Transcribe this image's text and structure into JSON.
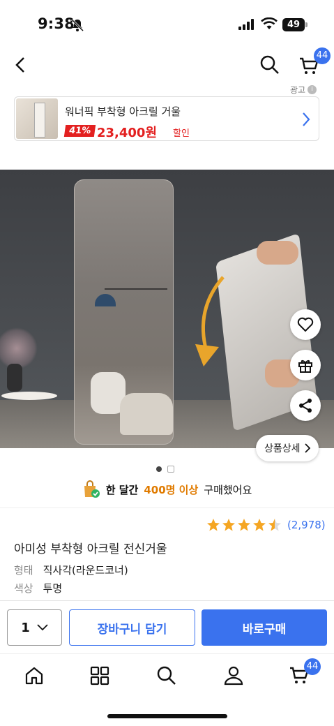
{
  "status_bar": {
    "time": "9:38",
    "battery": "49"
  },
  "header": {
    "cart_count": "44"
  },
  "ad": {
    "label": "광고",
    "title": "워너픽 부착형 아크릴 거울",
    "discount": "41%",
    "price": "23,400원",
    "sale_label": "할인"
  },
  "gallery": {
    "detail_button": "상품상세"
  },
  "popularity": {
    "prefix": "한 달간",
    "highlight": "400명 이상",
    "suffix": "구매했어요"
  },
  "rating": {
    "stars": 4.5,
    "count": "(2,978)"
  },
  "product": {
    "name": "아미성 부착형 아크릴 전신거울",
    "options": [
      {
        "key": "형태",
        "value": "직사각(라운드코너)"
      },
      {
        "key": "색상",
        "value": "투명"
      }
    ]
  },
  "purchase": {
    "quantity": "1",
    "add_to_cart": "장바구니 담기",
    "buy_now": "바로구매"
  },
  "tabbar": {
    "cart_count": "44"
  },
  "colors": {
    "accent": "#3a72ee",
    "sale": "#e32020",
    "highlight": "#e07b00"
  }
}
